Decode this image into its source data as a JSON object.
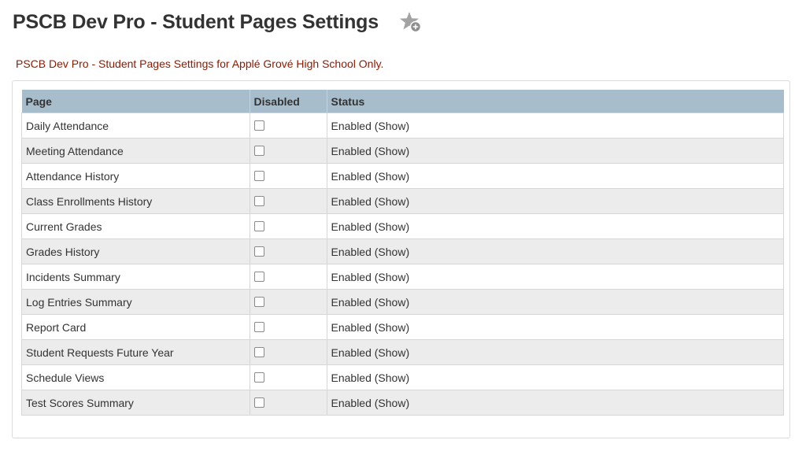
{
  "header": {
    "title": "PSCB Dev Pro - Student Pages Settings",
    "favorite_icon": "star-add-icon"
  },
  "subtitle": "PSCB Dev Pro - Student Pages Settings for Applé Grové High School Only.",
  "colors": {
    "subtitle": "#8a1a00",
    "table_header_bg": "#a8bdcc",
    "row_alt_bg": "#ececec"
  },
  "table": {
    "columns": [
      "Page",
      "Disabled",
      "Status"
    ],
    "rows": [
      {
        "page": "Daily Attendance",
        "disabled": false,
        "status": "Enabled (Show)"
      },
      {
        "page": "Meeting Attendance",
        "disabled": false,
        "status": "Enabled (Show)"
      },
      {
        "page": "Attendance History",
        "disabled": false,
        "status": "Enabled (Show)"
      },
      {
        "page": "Class Enrollments History",
        "disabled": false,
        "status": "Enabled (Show)"
      },
      {
        "page": "Current Grades",
        "disabled": false,
        "status": "Enabled (Show)"
      },
      {
        "page": "Grades History",
        "disabled": false,
        "status": "Enabled (Show)"
      },
      {
        "page": "Incidents Summary",
        "disabled": false,
        "status": "Enabled (Show)"
      },
      {
        "page": "Log Entries Summary",
        "disabled": false,
        "status": "Enabled (Show)"
      },
      {
        "page": "Report Card",
        "disabled": false,
        "status": "Enabled (Show)"
      },
      {
        "page": "Student Requests Future Year",
        "disabled": false,
        "status": "Enabled (Show)"
      },
      {
        "page": "Schedule Views",
        "disabled": false,
        "status": "Enabled (Show)"
      },
      {
        "page": "Test Scores Summary",
        "disabled": false,
        "status": "Enabled (Show)"
      }
    ]
  }
}
